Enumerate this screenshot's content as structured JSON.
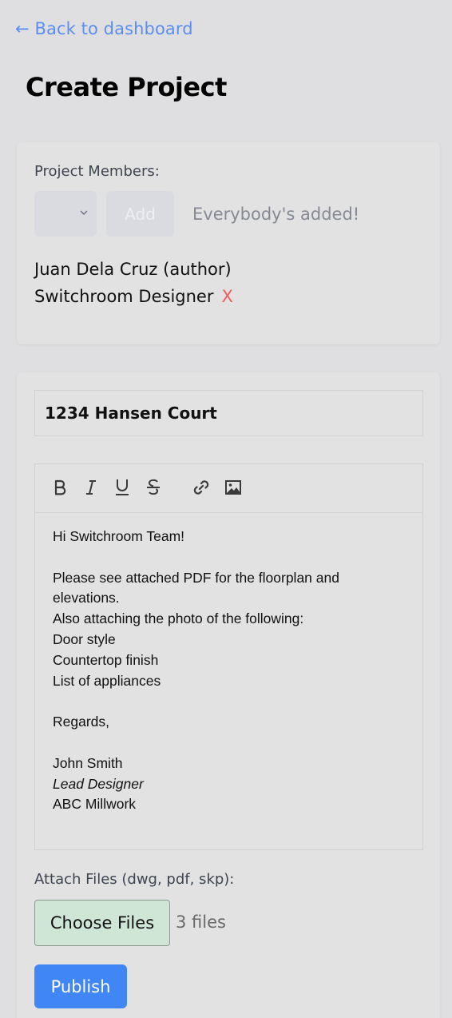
{
  "nav": {
    "back_label": "← Back to dashboard"
  },
  "page": {
    "title": "Create Project"
  },
  "members": {
    "label": "Project Members:",
    "select_value": "",
    "add_label": "Add",
    "status_text": "Everybody's added!",
    "list": [
      {
        "name": "Juan Dela Cruz (author)",
        "removable": false
      },
      {
        "name": "Switchroom Designer",
        "removable": true,
        "remove_label": "X"
      }
    ]
  },
  "form": {
    "title_value": "1234 Hansen Court",
    "toolbar": [
      "bold-icon",
      "italic-icon",
      "underline-icon",
      "strikethrough-icon",
      "link-icon",
      "image-icon"
    ],
    "body_lines": [
      "Hi Switchroom Team!",
      "",
      "Please see attached PDF for the floorplan and",
      "elevations.",
      "Also attaching the photo of the following:",
      "Door style",
      "Countertop finish",
      "List of appliances",
      "",
      "Regards,",
      "",
      "John Smith",
      "Lead Designer",
      "ABC Millwork"
    ],
    "attach_label": "Attach Files (dwg, pdf, skp):",
    "choose_label": "Choose Files",
    "files_count": "3 files",
    "publish_label": "Publish"
  },
  "colors": {
    "background": "#dfdfe1",
    "link": "#5b8ef0",
    "remove": "#f05a5a",
    "publish": "#4186f5",
    "choose_files": "#cfe6d6"
  }
}
